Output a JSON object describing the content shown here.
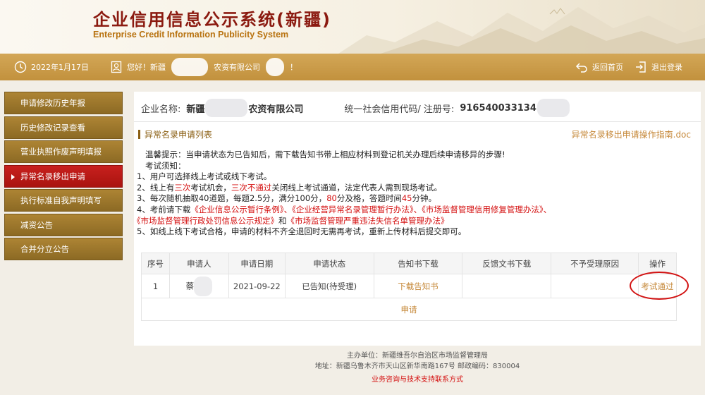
{
  "header": {
    "title": "企业信用信息公示系统(新疆)",
    "subtitle": "Enterprise Credit Information Publicity System"
  },
  "topbar": {
    "date": "2022年1月17日",
    "greeting_prefix": "您好！新疆",
    "greeting_mid": "农资有限公司",
    "greeting_suffix": "！",
    "home_label": "返回首页",
    "logout_label": "退出登录"
  },
  "sidebar": {
    "items": [
      {
        "label": "申请修改历史年报",
        "active": false
      },
      {
        "label": "历史修改记录查看",
        "active": false
      },
      {
        "label": "营业执照作废声明填报",
        "active": false
      },
      {
        "label": "异常名录移出申请",
        "active": true
      },
      {
        "label": "执行标准自我声明填写",
        "active": false
      },
      {
        "label": "减资公告",
        "active": false
      },
      {
        "label": "合并分立公告",
        "active": false
      }
    ]
  },
  "company": {
    "name_label": "企业名称:",
    "name_prefix": "新疆",
    "name_suffix": "农资有限公司",
    "code_label": "统一社会信用代码/ 注册号:",
    "code_value": "916540033134"
  },
  "section": {
    "title": "异常名录申请列表",
    "doc_link": "异常名录移出申请操作指南.doc"
  },
  "notice": {
    "tip": "温馨提示：当申请状态为已告知后，需下载告知书带上相应材料到登记机关办理后续申请移异的步骤!",
    "exam_head": "考试须知：",
    "l1": "1、用户可选择线上考试或线下考试。",
    "l2a": "2、线上有",
    "l2b": "三次",
    "l2c": "考试机会，",
    "l2d": "三次不通过",
    "l2e": "关闭线上考试通道，法定代表人需到现场考试。",
    "l3a": "3、每次随机抽取40道题，每题2.5分，满分100分，",
    "l3b": "80",
    "l3c": "分及格，答题时间",
    "l3d": "45",
    "l3e": "分钟。",
    "l4a": "4、考前请下载",
    "l4b": "《企业信息公示暂行条例》、《企业经营异常名录管理暂行办法》、《市场监督管理信用修复管理办法》、",
    "l4c": "《市场监督管理行政处罚信息公示规定》",
    "l4d": "和",
    "l4e": "《市场监督管理严重违法失信名单管理办法》",
    "l5": "5、如线上线下考试合格，申请的材料不齐全退回时无需再考试，重新上传材料后提交即可。"
  },
  "table": {
    "headers": [
      "序号",
      "申请人",
      "申请日期",
      "申请状态",
      "告知书下载",
      "反馈文书下载",
      "不予受理原因",
      "操作"
    ],
    "row": {
      "index": "1",
      "applicant": "蔡",
      "date": "2021-09-22",
      "status": "已告知(待受理)",
      "notice_download": "下载告知书",
      "feedback": "",
      "reason": "",
      "action": "考试通过"
    },
    "apply_label": "申请"
  },
  "footer": {
    "host": "主办单位：新疆维吾尔自治区市场监督管理局",
    "address": "地址：新疆乌鲁木齐市天山区新华南路167号    邮政编码：830004",
    "contact": "业务咨询与技术支持联系方式"
  },
  "colors": {
    "brand_red": "#8b1a10",
    "gold": "#c2913d",
    "active_red": "#c8201e",
    "highlight_red": "#d40e0e"
  }
}
